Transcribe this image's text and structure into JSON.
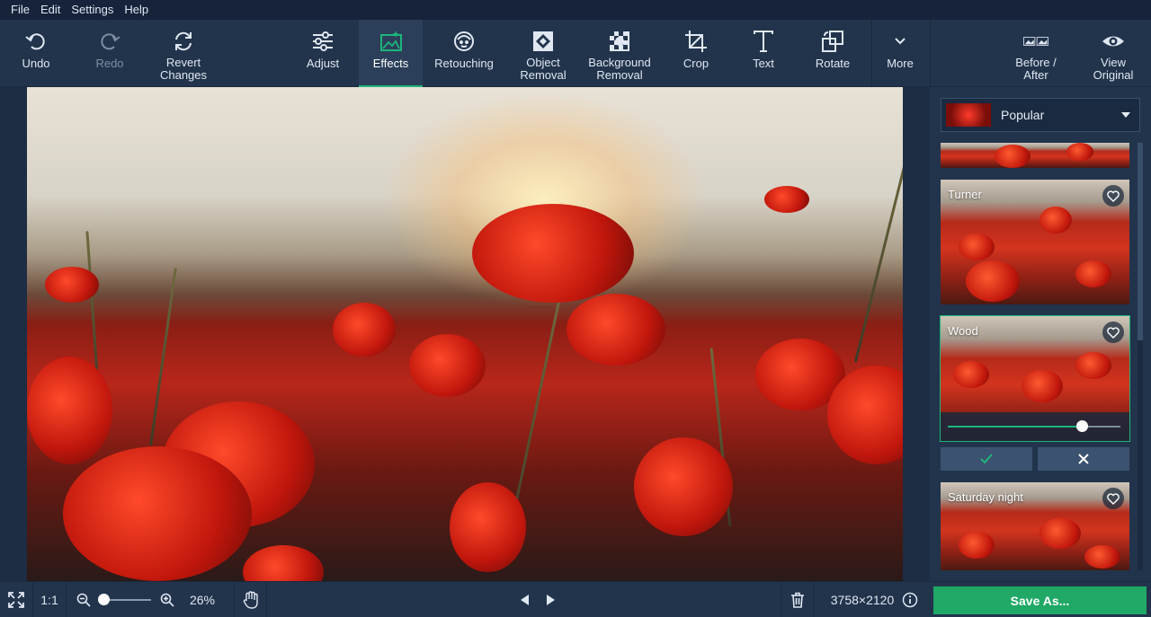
{
  "menu": [
    "File",
    "Edit",
    "Settings",
    "Help"
  ],
  "toolbar": {
    "undo": "Undo",
    "redo": "Redo",
    "revert": "Revert\nChanges",
    "adjust": "Adjust",
    "effects": "Effects",
    "retouching": "Retouching",
    "object_removal": "Object\nRemoval",
    "background_removal": "Background\nRemoval",
    "crop": "Crop",
    "text": "Text",
    "rotate": "Rotate",
    "more": "More",
    "before_after": "Before /\nAfter",
    "view_original": "View\nOriginal"
  },
  "panel": {
    "category": "Popular",
    "presets": [
      {
        "title": "Turner"
      },
      {
        "title": "Wood",
        "intensity": 0.78
      },
      {
        "title": "Saturday night"
      }
    ]
  },
  "status": {
    "fit_label": "1:1",
    "zoom": "26%",
    "zoom_level": 0.26,
    "dimensions": "3758×2120",
    "save": "Save As..."
  },
  "colors": {
    "accent": "#1fb57a",
    "save": "#1fa866"
  }
}
